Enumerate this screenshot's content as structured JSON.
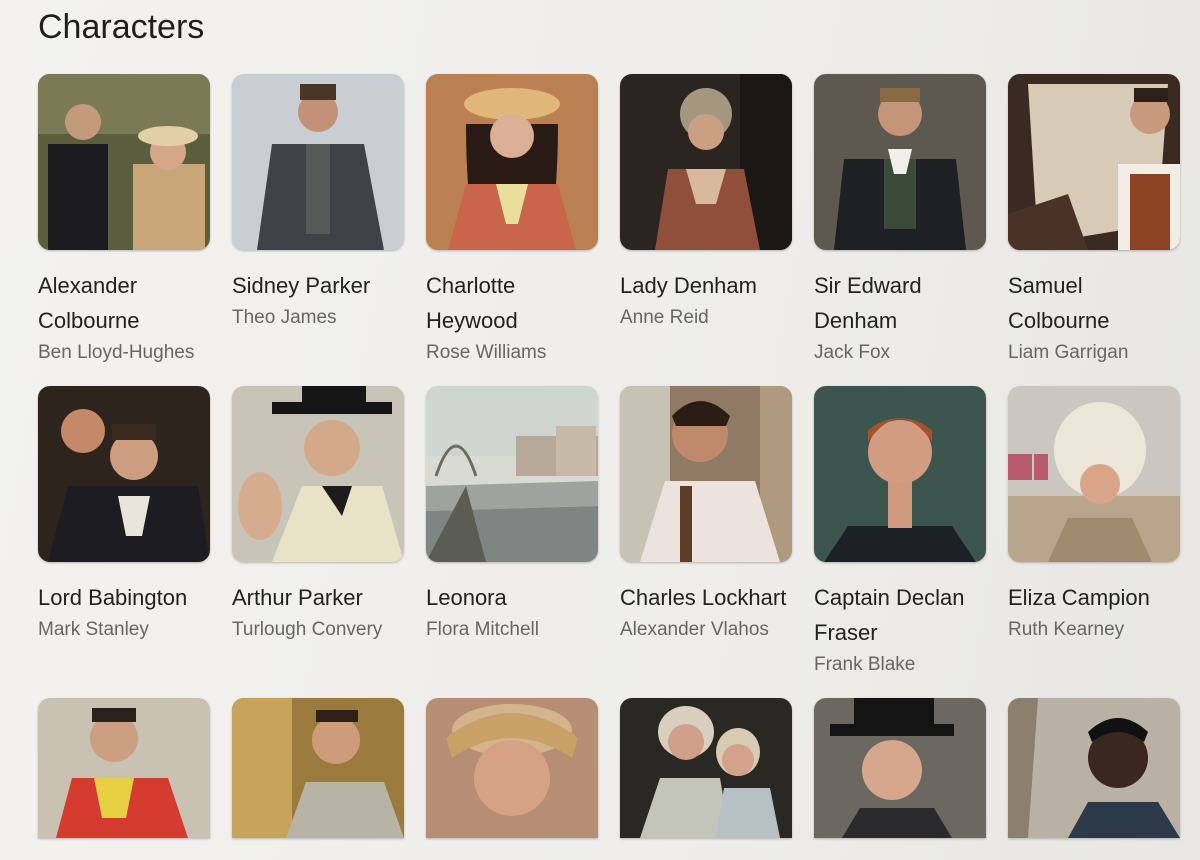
{
  "section": {
    "title": "Characters"
  },
  "rows": [
    [
      {
        "name": "Alexander Colbourne",
        "actor": "Ben Lloyd-Hughes"
      },
      {
        "name": "Sidney Parker",
        "actor": "Theo James"
      },
      {
        "name": "Charlotte Heywood",
        "actor": "Rose Williams"
      },
      {
        "name": "Lady Denham",
        "actor": "Anne Reid"
      },
      {
        "name": "Sir Edward Denham",
        "actor": "Jack Fox"
      },
      {
        "name": "Samuel Colbourne",
        "actor": "Liam Garrigan"
      }
    ],
    [
      {
        "name": "Lord Babington",
        "actor": "Mark Stanley"
      },
      {
        "name": "Arthur Parker",
        "actor": "Turlough Convery"
      },
      {
        "name": "Leonora",
        "actor": "Flora Mitchell"
      },
      {
        "name": "Charles Lockhart",
        "actor": "Alexander Vlahos"
      },
      {
        "name": "Captain Declan Fraser",
        "actor": "Frank Blake"
      },
      {
        "name": "Eliza Campion",
        "actor": "Ruth Kearney"
      }
    ]
  ],
  "row3_count": 6
}
